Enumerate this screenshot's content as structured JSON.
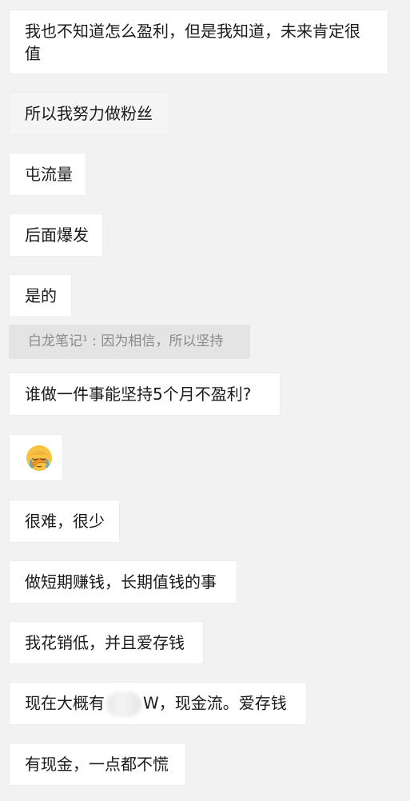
{
  "messages": [
    {
      "text": "我也不知道怎么盈利，但是我知道，未来肯定很值"
    },
    {
      "text": "所以我努力做粉丝"
    },
    {
      "text": "屯流量"
    },
    {
      "text": "后面爆发"
    },
    {
      "text": "是的"
    },
    {
      "quote": "白龙笔记¹ : 因为相信，所以坚持"
    },
    {
      "text": "谁做一件事能坚持5个月不盈利?"
    },
    {
      "emoji": "facepalm-emoji"
    },
    {
      "text": "很难，很少"
    },
    {
      "text": "做短期赚钱，长期值钱的事"
    },
    {
      "text": "我花销低，并且爱存钱"
    },
    {
      "text_before": "现在大概有",
      "text_after": "W，现金流。爱存钱"
    },
    {
      "text": "有现金，一点都不慌"
    }
  ]
}
